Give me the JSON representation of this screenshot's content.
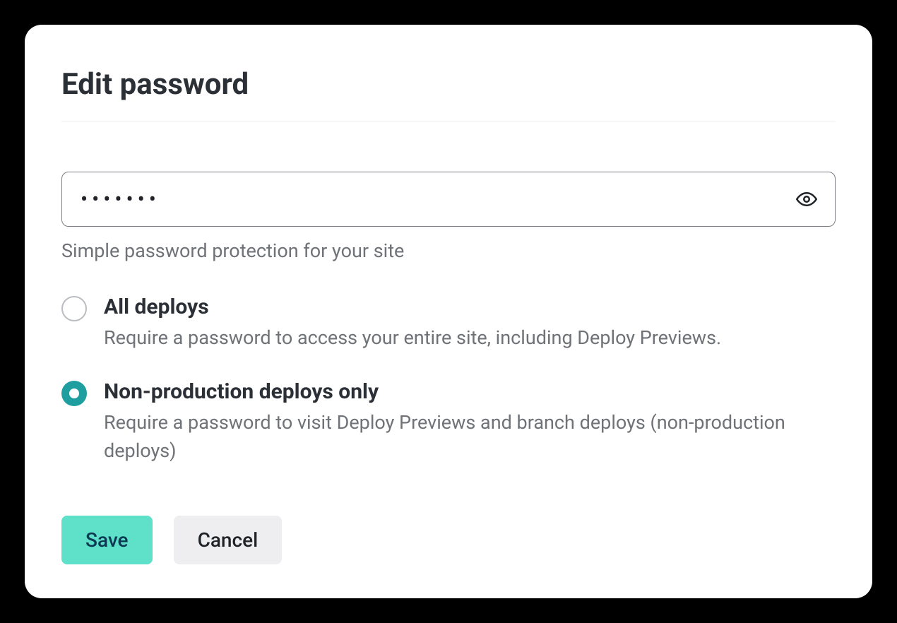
{
  "title": "Edit password",
  "password": {
    "value": "•••••••",
    "hint": "Simple password protection for your site"
  },
  "options": [
    {
      "label": "All deploys",
      "description": "Require a password to access your entire site, including Deploy Previews.",
      "selected": false
    },
    {
      "label": "Non-production deploys only",
      "description": "Require a password to visit Deploy Previews and branch deploys (non-production deploys)",
      "selected": true
    }
  ],
  "actions": {
    "save": "Save",
    "cancel": "Cancel"
  }
}
